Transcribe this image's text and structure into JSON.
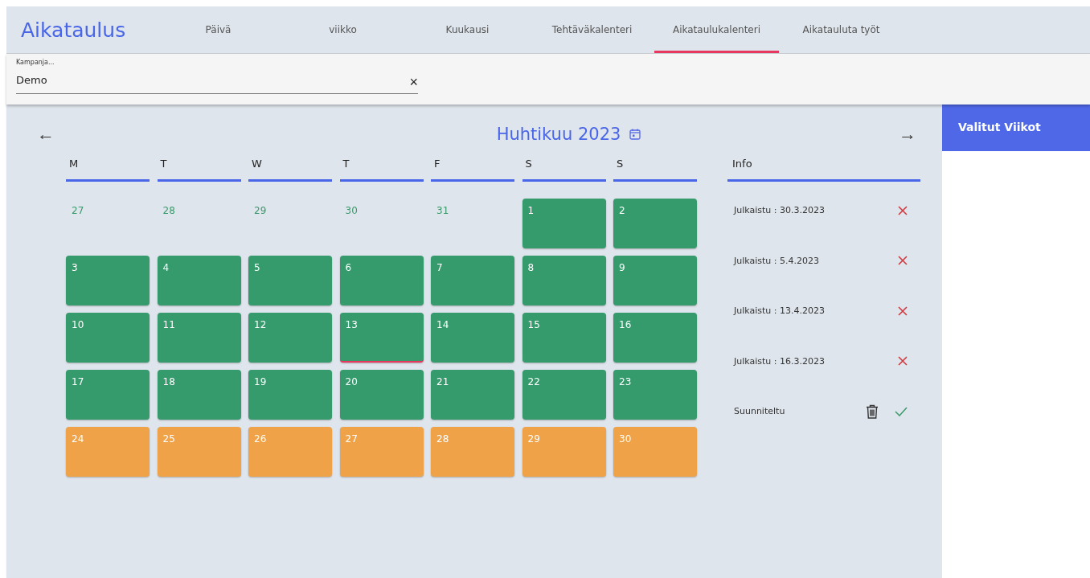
{
  "app_title": "Aikataulus",
  "tabs": [
    {
      "label": "Päivä",
      "selected": false
    },
    {
      "label": "viikko",
      "selected": false
    },
    {
      "label": "Kuukausi",
      "selected": false
    },
    {
      "label": "Tehtäväkalenteri",
      "selected": false
    },
    {
      "label": "Aikataulukalenteri",
      "selected": true
    },
    {
      "label": "Aikatauluta työt",
      "selected": false
    }
  ],
  "campaign_field": {
    "label": "Kampanja...",
    "value": "Demo",
    "clear": "×"
  },
  "calendar": {
    "title": "Huhtikuu 2023",
    "prev": "←",
    "next": "→",
    "weekdays": [
      "M",
      "T",
      "W",
      "T",
      "F",
      "S",
      "S"
    ],
    "days": [
      {
        "day": "27",
        "kind": "outside",
        "today": false
      },
      {
        "day": "28",
        "kind": "outside",
        "today": false
      },
      {
        "day": "29",
        "kind": "outside",
        "today": false
      },
      {
        "day": "30",
        "kind": "outside",
        "today": false
      },
      {
        "day": "31",
        "kind": "outside",
        "today": false
      },
      {
        "day": "1",
        "kind": "published",
        "today": false
      },
      {
        "day": "2",
        "kind": "published",
        "today": false
      },
      {
        "day": "3",
        "kind": "published",
        "today": false
      },
      {
        "day": "4",
        "kind": "published",
        "today": false
      },
      {
        "day": "5",
        "kind": "published",
        "today": false
      },
      {
        "day": "6",
        "kind": "published",
        "today": false
      },
      {
        "day": "7",
        "kind": "published",
        "today": false
      },
      {
        "day": "8",
        "kind": "published",
        "today": false
      },
      {
        "day": "9",
        "kind": "published",
        "today": false
      },
      {
        "day": "10",
        "kind": "published",
        "today": false
      },
      {
        "day": "11",
        "kind": "published",
        "today": false
      },
      {
        "day": "12",
        "kind": "published",
        "today": false
      },
      {
        "day": "13",
        "kind": "published",
        "today": true
      },
      {
        "day": "14",
        "kind": "published",
        "today": false
      },
      {
        "day": "15",
        "kind": "published",
        "today": false
      },
      {
        "day": "16",
        "kind": "published",
        "today": false
      },
      {
        "day": "17",
        "kind": "published",
        "today": false
      },
      {
        "day": "18",
        "kind": "published",
        "today": false
      },
      {
        "day": "19",
        "kind": "published",
        "today": false
      },
      {
        "day": "20",
        "kind": "published",
        "today": false
      },
      {
        "day": "21",
        "kind": "published",
        "today": false
      },
      {
        "day": "22",
        "kind": "published",
        "today": false
      },
      {
        "day": "23",
        "kind": "published",
        "today": false
      },
      {
        "day": "24",
        "kind": "planned",
        "today": false
      },
      {
        "day": "25",
        "kind": "planned",
        "today": false
      },
      {
        "day": "26",
        "kind": "planned",
        "today": false
      },
      {
        "day": "27",
        "kind": "planned",
        "today": false
      },
      {
        "day": "28",
        "kind": "planned",
        "today": false
      },
      {
        "day": "29",
        "kind": "planned",
        "today": false
      },
      {
        "day": "30",
        "kind": "planned",
        "today": false
      }
    ]
  },
  "info": {
    "heading": "Info",
    "rows": [
      {
        "text": "Julkaistu : 30.3.2023",
        "kind": "published"
      },
      {
        "text": "Julkaistu : 5.4.2023",
        "kind": "published"
      },
      {
        "text": "Julkaistu : 13.4.2023",
        "kind": "published"
      },
      {
        "text": "Julkaistu : 16.3.2023",
        "kind": "published"
      },
      {
        "text": "Suunniteltu",
        "kind": "planned"
      }
    ]
  },
  "side_panel": {
    "title": "Valitut Viikot"
  }
}
